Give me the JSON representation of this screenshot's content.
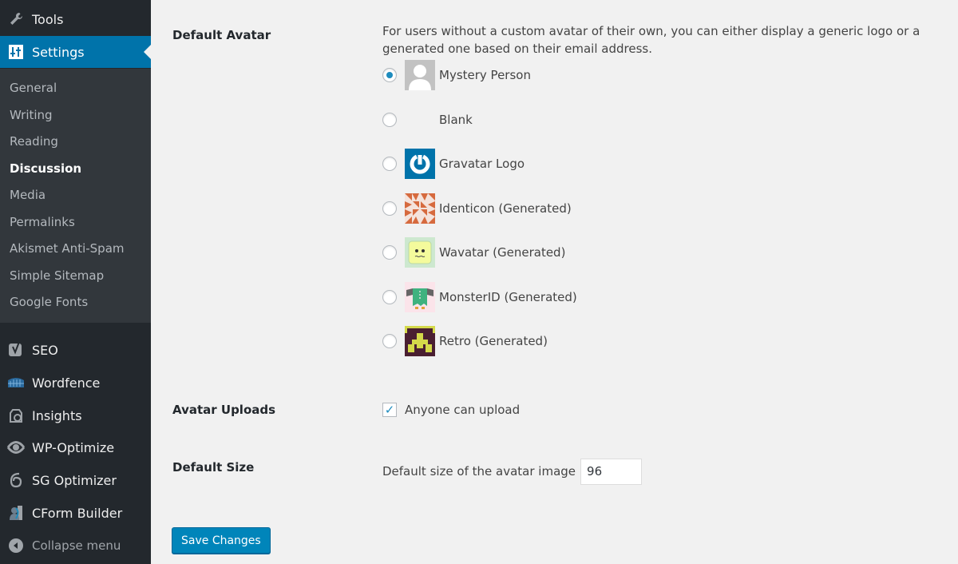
{
  "sidebar": {
    "top_items": [
      {
        "label": "Tools",
        "icon": "wrench-icon"
      },
      {
        "label": "Settings",
        "icon": "sliders-icon",
        "active": true
      }
    ],
    "submenu": [
      "General",
      "Writing",
      "Reading",
      "Discussion",
      "Media",
      "Permalinks",
      "Akismet Anti-Spam",
      "Simple Sitemap",
      "Google Fonts"
    ],
    "current_sub": "Discussion",
    "plugin_items": [
      {
        "label": "SEO",
        "icon": "yoast-icon"
      },
      {
        "label": "Wordfence",
        "icon": "wordfence-icon"
      },
      {
        "label": "Insights",
        "icon": "insights-icon"
      },
      {
        "label": "WP-Optimize",
        "icon": "wp-optimize-icon"
      },
      {
        "label": "SG Optimizer",
        "icon": "sg-optimizer-icon"
      },
      {
        "label": "CForm Builder",
        "icon": "cform-icon"
      }
    ],
    "collapse_label": "Collapse menu"
  },
  "default_avatar": {
    "label": "Default Avatar",
    "description": "For users without a custom avatar of their own, you can either display a generic logo or a generated one based on their email address.",
    "options": [
      {
        "label": "Mystery Person",
        "selected": true
      },
      {
        "label": "Blank",
        "selected": false
      },
      {
        "label": "Gravatar Logo",
        "selected": false
      },
      {
        "label": "Identicon (Generated)",
        "selected": false
      },
      {
        "label": "Wavatar (Generated)",
        "selected": false
      },
      {
        "label": "MonsterID (Generated)",
        "selected": false
      },
      {
        "label": "Retro (Generated)",
        "selected": false
      }
    ]
  },
  "avatar_uploads": {
    "label": "Avatar Uploads",
    "checkbox_label": "Anyone can upload",
    "checked": true
  },
  "default_size": {
    "label": "Default Size",
    "field_label": "Default size of the avatar image",
    "value": "96"
  },
  "save_label": "Save Changes",
  "colors": {
    "accent": "#0073aa",
    "sidebar_bg": "#23282d",
    "button": "#0085ba"
  }
}
